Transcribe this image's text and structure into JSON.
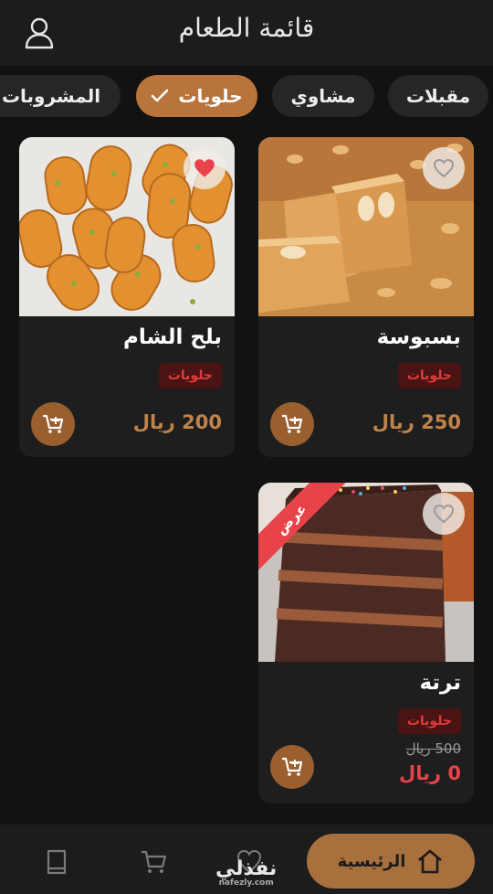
{
  "header": {
    "title": "قائمة الطعام",
    "user_icon": "user-icon"
  },
  "tabs": [
    {
      "label": "مقبلات",
      "active": false
    },
    {
      "label": "مشاوي",
      "active": false
    },
    {
      "label": "حلويات",
      "active": true
    },
    {
      "label": "المشروبات",
      "active": false
    }
  ],
  "products": [
    {
      "name": "بسبوسة",
      "category": "حلويات",
      "price": "250 ريال",
      "favorite": false
    },
    {
      "name": "بلح الشام",
      "category": "حلويات",
      "price": "200 ريال",
      "favorite": true
    },
    {
      "name": "ترتة",
      "category": "حلويات",
      "old_price": "500 ريال",
      "price": "0 ريال",
      "favorite": false,
      "ribbon": "عرض"
    }
  ],
  "bottom_nav": {
    "home_label": "الرئيسية"
  },
  "watermark": {
    "ar": "نفذلي",
    "en": "nafezly.com"
  },
  "colors": {
    "accent": "#b8743a",
    "background": "#121212",
    "card": "#1e1e1e",
    "badge_text": "#e23b3b",
    "sale_price": "#e8434a"
  }
}
